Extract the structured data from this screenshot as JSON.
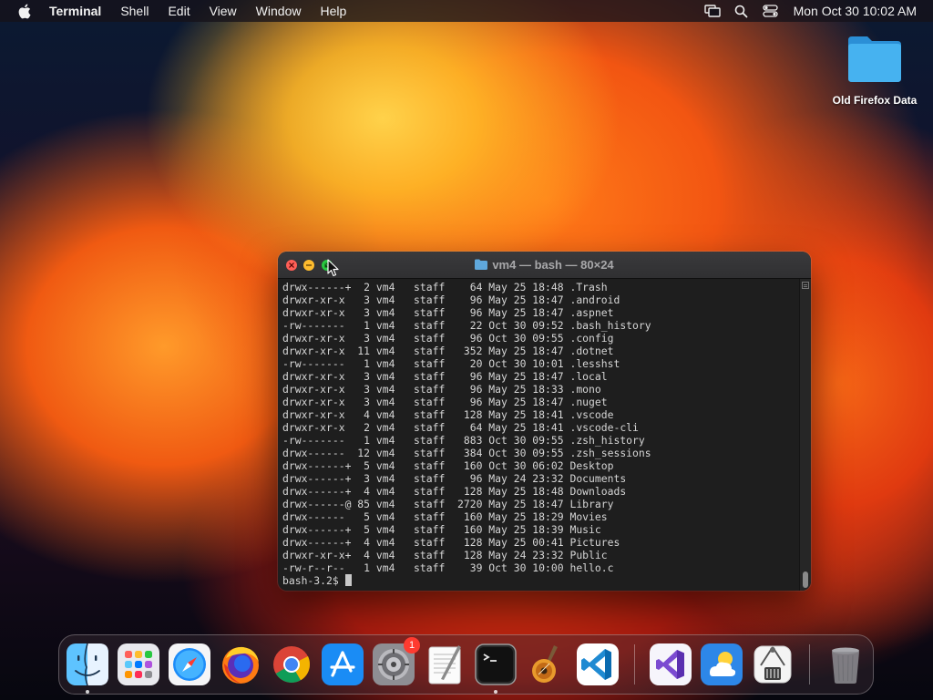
{
  "menubar": {
    "app_name": "Terminal",
    "menus": [
      "Shell",
      "Edit",
      "View",
      "Window",
      "Help"
    ],
    "clock": "Mon Oct 30  10:02 AM",
    "status_icons": [
      "screen-mirroring-icon",
      "search-icon",
      "control-center-icon"
    ]
  },
  "desktop": {
    "folder_label": "Old Firefox Data",
    "folder_color": "#3aa3e8"
  },
  "terminal": {
    "title": "vm4 — bash — 80×24",
    "lines": [
      "drwx------+  2 vm4   staff    64 May 25 18:48 .Trash",
      "drwxr-xr-x   3 vm4   staff    96 May 25 18:47 .android",
      "drwxr-xr-x   3 vm4   staff    96 May 25 18:47 .aspnet",
      "-rw-------   1 vm4   staff    22 Oct 30 09:52 .bash_history",
      "drwxr-xr-x   3 vm4   staff    96 Oct 30 09:55 .config",
      "drwxr-xr-x  11 vm4   staff   352 May 25 18:47 .dotnet",
      "-rw-------   1 vm4   staff    20 Oct 30 10:01 .lesshst",
      "drwxr-xr-x   3 vm4   staff    96 May 25 18:47 .local",
      "drwxr-xr-x   3 vm4   staff    96 May 25 18:33 .mono",
      "drwxr-xr-x   3 vm4   staff    96 May 25 18:47 .nuget",
      "drwxr-xr-x   4 vm4   staff   128 May 25 18:41 .vscode",
      "drwxr-xr-x   2 vm4   staff    64 May 25 18:41 .vscode-cli",
      "-rw-------   1 vm4   staff   883 Oct 30 09:55 .zsh_history",
      "drwx------  12 vm4   staff   384 Oct 30 09:55 .zsh_sessions",
      "drwx------+  5 vm4   staff   160 Oct 30 06:02 Desktop",
      "drwx------+  3 vm4   staff    96 May 24 23:32 Documents",
      "drwx------+  4 vm4   staff   128 May 25 18:48 Downloads",
      "drwx------@ 85 vm4   staff  2720 May 25 18:47 Library",
      "drwx------   5 vm4   staff   160 May 25 18:29 Movies",
      "drwx------+  5 vm4   staff   160 May 25 18:39 Music",
      "drwx------+  4 vm4   staff   128 May 25 00:41 Pictures",
      "drwxr-xr-x+  4 vm4   staff   128 May 24 23:32 Public",
      "-rw-r--r--   1 vm4   staff    39 Oct 30 10:00 hello.c"
    ],
    "prompt": "bash-3.2$ ",
    "colors": {
      "background": "#1e1e1e",
      "text": "#d6d6d6"
    }
  },
  "dock": {
    "apps": [
      {
        "name": "finder-icon",
        "running": true
      },
      {
        "name": "launchpad-icon",
        "running": false
      },
      {
        "name": "safari-icon",
        "running": false
      },
      {
        "name": "firefox-icon",
        "running": false
      },
      {
        "name": "chrome-icon",
        "running": false
      },
      {
        "name": "app-store-icon",
        "running": false
      },
      {
        "name": "system-settings-icon",
        "running": false,
        "badge": "1"
      },
      {
        "name": "textedit-icon",
        "running": false
      },
      {
        "name": "terminal-icon",
        "running": true
      },
      {
        "name": "garageband-icon",
        "running": false
      },
      {
        "name": "vscode-icon",
        "running": false
      },
      {
        "name": "visual-studio-icon",
        "running": false
      },
      {
        "name": "weather-icon",
        "running": false
      },
      {
        "name": "archive-utility-icon",
        "running": false
      },
      {
        "name": "trash-icon",
        "running": false
      }
    ]
  }
}
